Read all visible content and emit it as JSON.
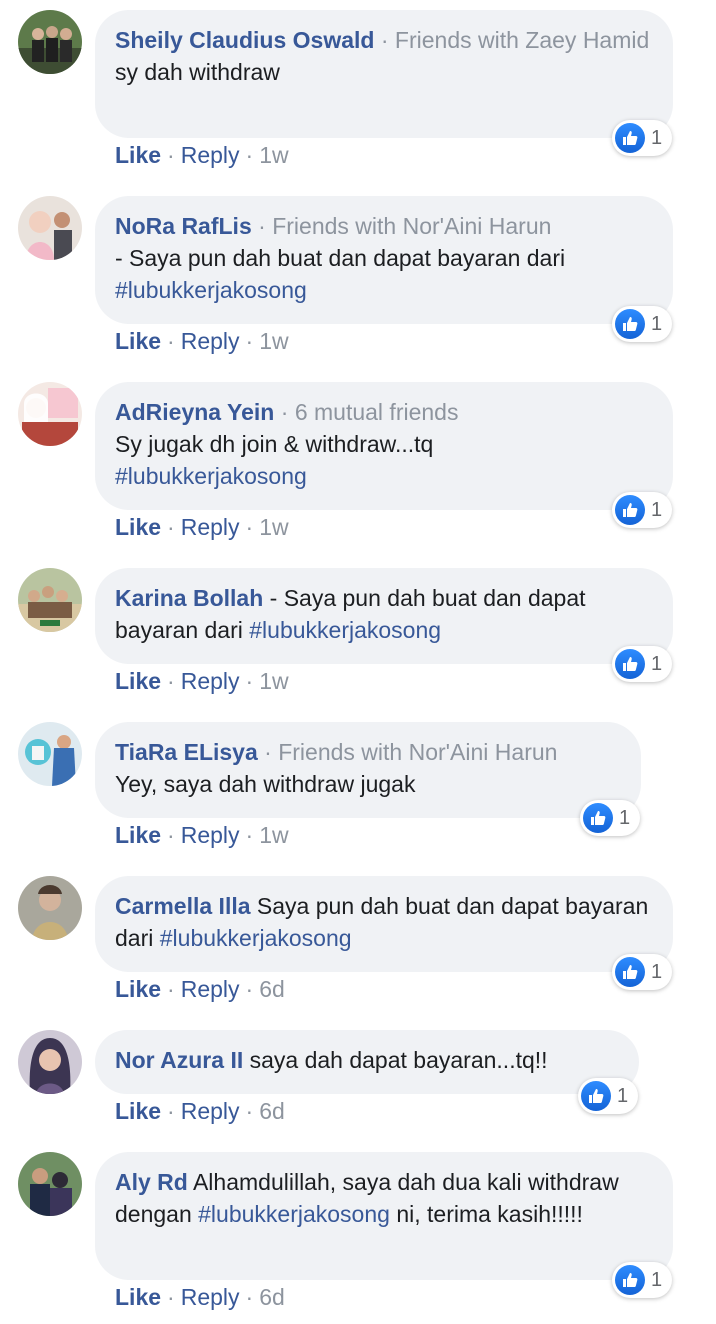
{
  "comments": [
    {
      "name": "Sheily Claudius Oswald",
      "meta": "Friends with Zaey Hamid",
      "text": "sy dah withdraw",
      "hashtag": "",
      "likes": "1",
      "time": "1w"
    },
    {
      "name": "NoRa RafLis",
      "meta": "Friends with Nor'Aini Harun",
      "text": "- Saya pun dah buat dan dapat bayaran dari",
      "hashtag": "#lubukkerjakosong",
      "likes": "1",
      "time": "1w"
    },
    {
      "name": "AdRieyna Yein",
      "meta": "6 mutual friends",
      "text": "Sy jugak dh join & withdraw...tq",
      "hashtag": "#lubukkerjakosong",
      "likes": "1",
      "time": "1w"
    },
    {
      "name": "Karina Bollah",
      "meta": "",
      "text": "- Saya pun dah buat dan dapat bayaran dari",
      "hashtag": "#lubukkerjakosong",
      "likes": "1",
      "time": "1w"
    },
    {
      "name": "TiaRa ELisya",
      "meta": "Friends with Nor'Aini Harun",
      "text": "Yey, saya dah withdraw jugak",
      "hashtag": "",
      "likes": "1",
      "time": "1w"
    },
    {
      "name": "Carmella Illa",
      "meta": "",
      "text": "Saya pun dah buat dan dapat bayaran dari",
      "hashtag": "#lubukkerjakosong",
      "likes": "1",
      "time": "6d"
    },
    {
      "name": "Nor Azura II",
      "meta": "",
      "text": "saya dah dapat bayaran...tq!!",
      "hashtag": "",
      "likes": "1",
      "time": "6d"
    },
    {
      "name": "Aly Rd",
      "meta": "",
      "text": "Alhamdulillah, saya dah dua kali withdraw dengan",
      "hashtag": "#lubukkerjakosong",
      "text_after": "ni, terima kasih!!!!!",
      "likes": "1",
      "time": "6d"
    }
  ],
  "actions": {
    "like": "Like",
    "reply": "Reply",
    "separator": "·"
  },
  "colors": {
    "name": "#385898",
    "meta": "#8d949e",
    "bubble": "#f0f2f5",
    "like_blue": "#1877f2"
  },
  "icons": {
    "reaction": "thumbs-up-icon"
  }
}
